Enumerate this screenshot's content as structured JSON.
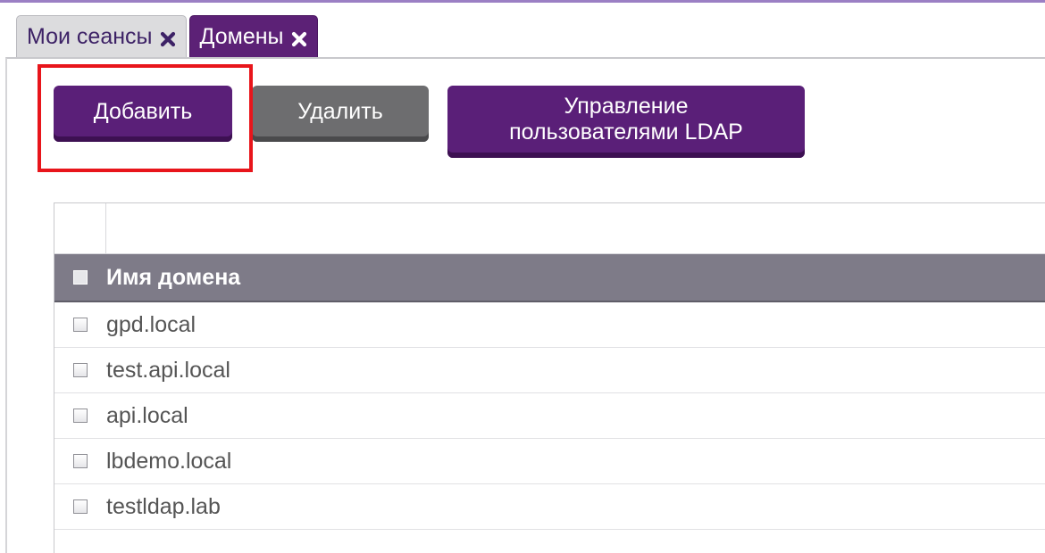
{
  "tabs": [
    {
      "label": "Мои сеансы",
      "icon": "close-icon",
      "active": false
    },
    {
      "label": "Домены",
      "icon": "close-icon",
      "active": true
    }
  ],
  "toolbar": {
    "add_label": "Добавить",
    "delete_label": "Удалить",
    "ldap_line1": "Управление",
    "ldap_line2": "пользователями LDAP"
  },
  "grid": {
    "column_header": "Имя домена",
    "rows": [
      "gpd.local",
      "test.api.local",
      "api.local",
      "lbdemo.local",
      "testldap.lab"
    ]
  },
  "colors": {
    "accent": "#5a1f78",
    "highlight": "#e8151b",
    "header_bg": "#7e7b88",
    "secondary_button": "#6d6d6f"
  }
}
